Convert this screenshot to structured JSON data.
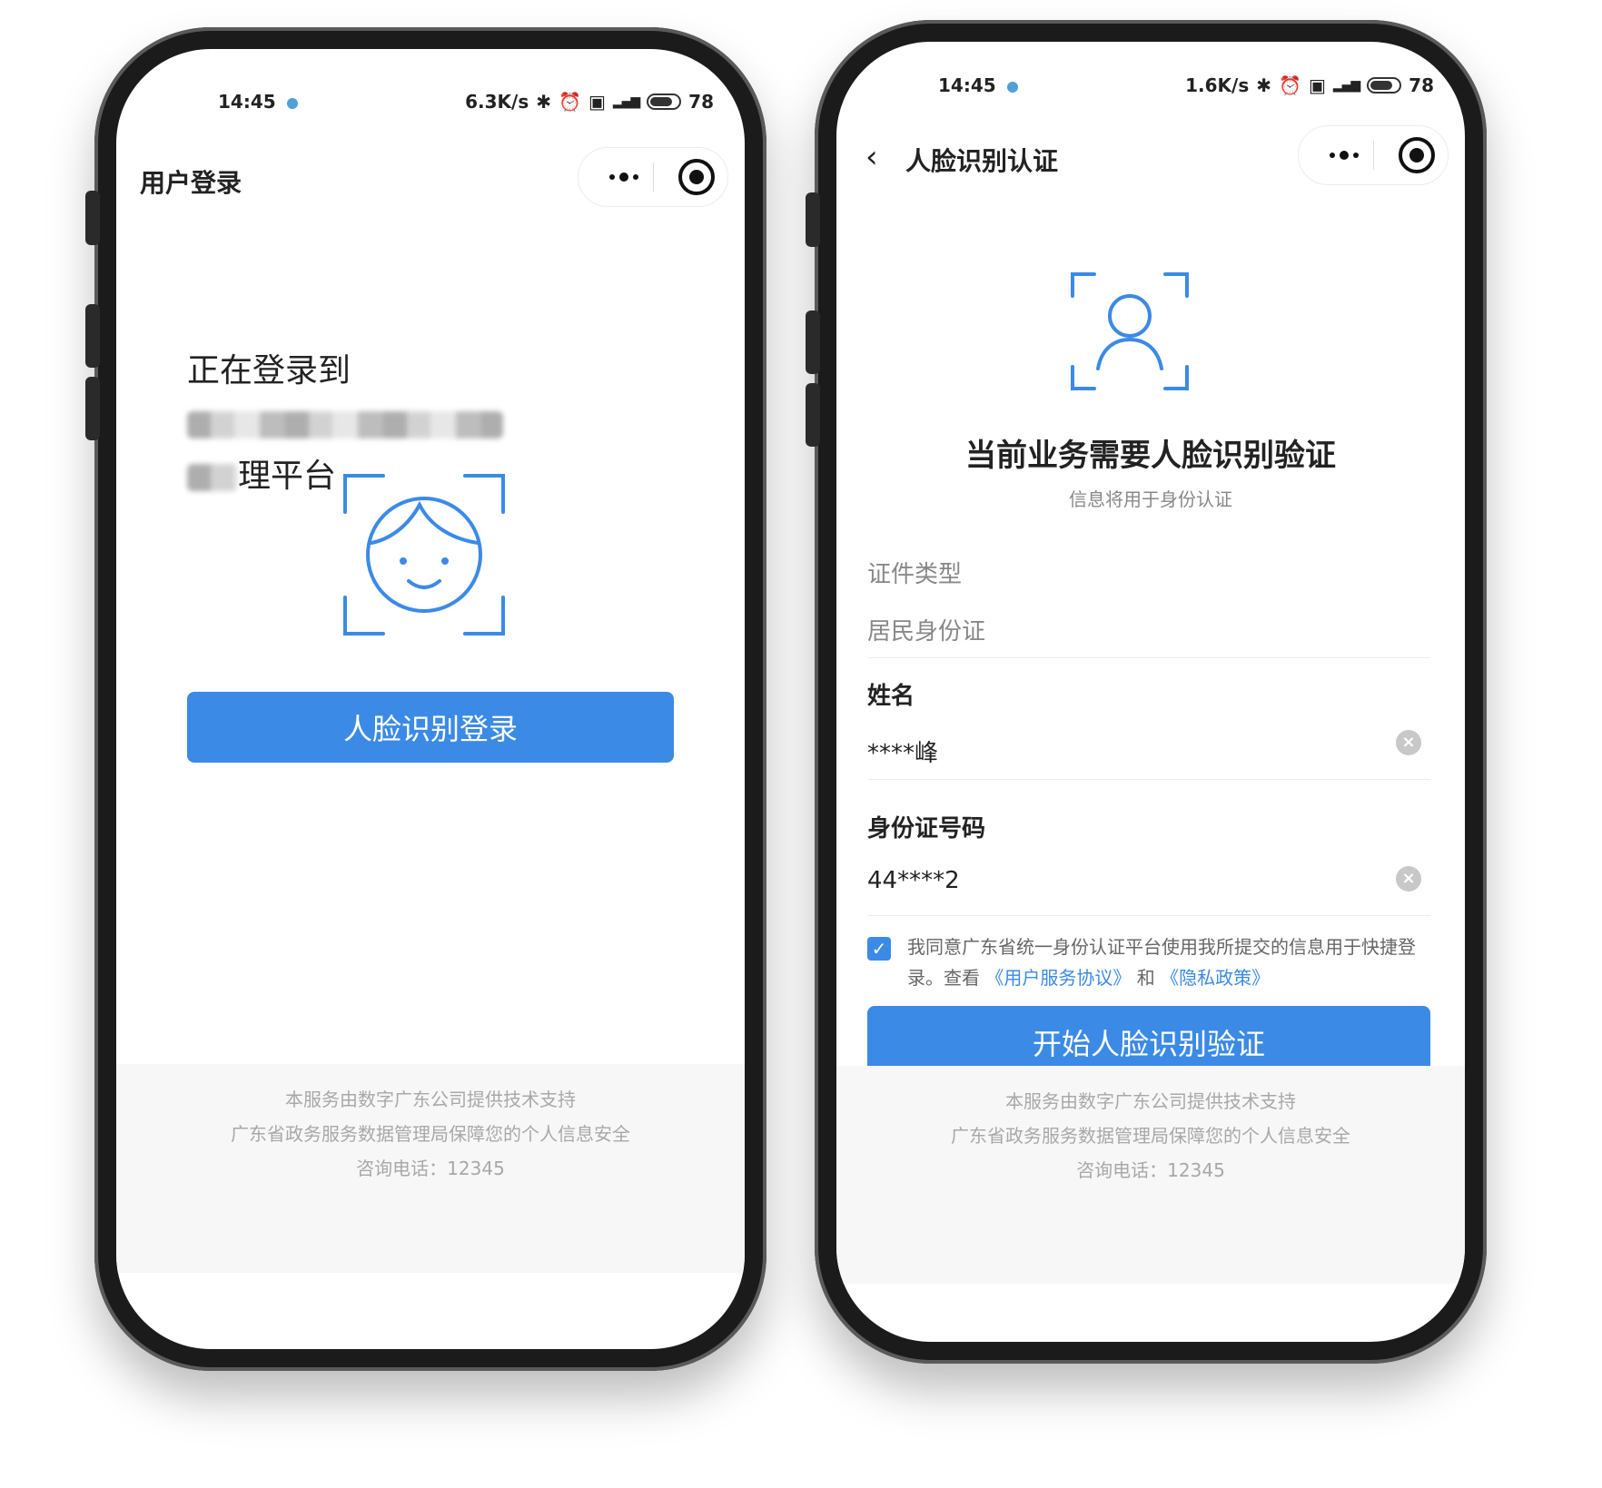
{
  "left_phone": {
    "status": {
      "time": "14:45",
      "speed": "6.3K/s",
      "battery": "78"
    },
    "nav_title": "用户登录",
    "login_prefix": "正在登录到",
    "login_suffix": "理平台",
    "button_label": "人脸识别登录",
    "footer": {
      "line1": "本服务由数字广东公司提供技术支持",
      "line2": "广东省政务服务数据管理局保障您的个人信息安全",
      "line3": "咨询电话：12345"
    }
  },
  "right_phone": {
    "status": {
      "time": "14:45",
      "speed": "1.6K/s",
      "battery": "78"
    },
    "nav_title": "人脸识别认证",
    "headline": "当前业务需要人脸识别验证",
    "subtitle": "信息将用于身份认证",
    "fields": {
      "id_type": {
        "label": "证件类型",
        "value": "居民身份证"
      },
      "name": {
        "label": "姓名",
        "value": "****峰"
      },
      "id_number": {
        "label": "身份证号码",
        "value": "44****2"
      }
    },
    "agreement": {
      "text": "我同意广东省统一身份认证平台使用我所提交的信息用于快捷登录。查看",
      "link1": "《用户服务协议》",
      "and": "和",
      "link2": "《隐私政策》"
    },
    "button_label": "开始人脸识别验证",
    "footer": {
      "line1": "本服务由数字广东公司提供技术支持",
      "line2": "广东省政务服务数据管理局保障您的个人信息安全",
      "line3": "咨询电话：12345"
    }
  },
  "colors": {
    "accent": "#3b8ae6",
    "footer_text": "#a8a8a8"
  },
  "icons": [
    "more-icon",
    "close-mini-program-icon",
    "back-icon",
    "face-scan-icon",
    "person-scan-icon",
    "clear-icon",
    "checkbox-checked-icon"
  ]
}
